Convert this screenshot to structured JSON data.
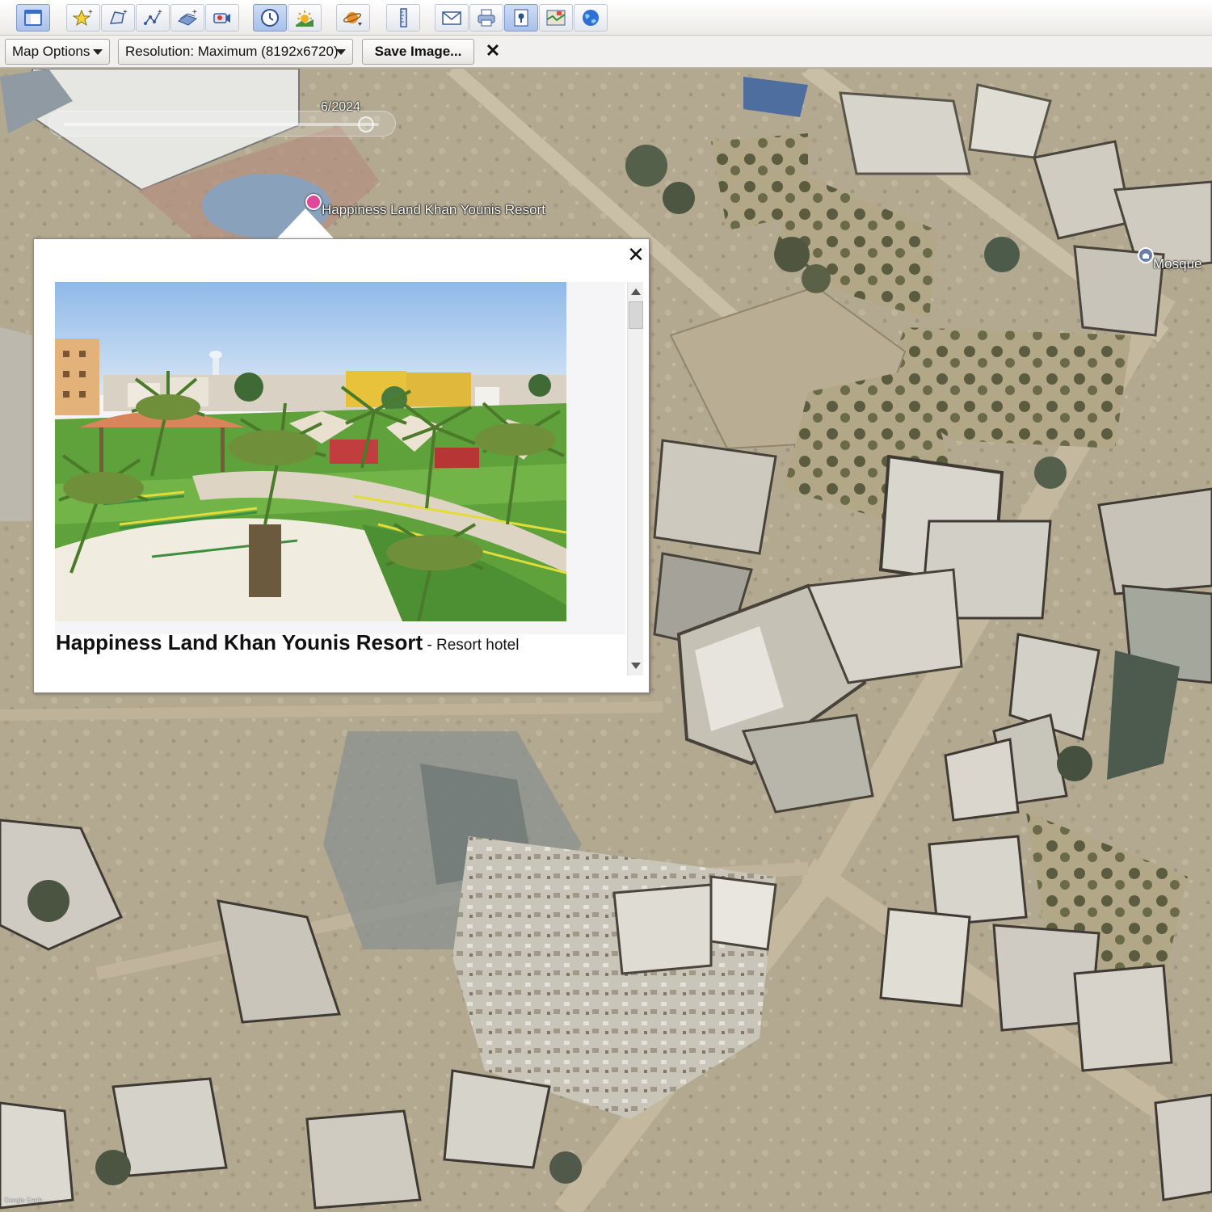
{
  "toolbar": {
    "buttons": [
      {
        "name": "sidebar-toggle",
        "icon": "sidebar-icon",
        "active": false
      },
      {
        "name": "add-placemark",
        "icon": "placemark-icon",
        "active": false
      },
      {
        "name": "add-polygon",
        "icon": "polygon-icon",
        "active": false
      },
      {
        "name": "add-path",
        "icon": "path-icon",
        "active": false
      },
      {
        "name": "add-image-overlay",
        "icon": "image-overlay-icon",
        "active": false
      },
      {
        "name": "record-tour",
        "icon": "record-tour-icon",
        "active": false
      },
      {
        "name": "historical-imagery",
        "icon": "clock-icon",
        "active": true
      },
      {
        "name": "sunlight",
        "icon": "sun-icon",
        "active": false
      },
      {
        "name": "switch-planet",
        "icon": "planet-icon",
        "active": false
      },
      {
        "name": "ruler",
        "icon": "ruler-icon",
        "active": false
      },
      {
        "name": "email",
        "icon": "email-icon",
        "active": false
      },
      {
        "name": "print",
        "icon": "print-icon",
        "active": false
      },
      {
        "name": "save-image",
        "icon": "save-image-icon",
        "active": true
      },
      {
        "name": "view-in-maps",
        "icon": "maps-icon",
        "active": false
      },
      {
        "name": "earth-community",
        "icon": "globe-icon",
        "active": false
      }
    ]
  },
  "options": {
    "map_options_label": "Map Options",
    "resolution_label": "Resolution: Maximum (8192x6720)",
    "save_image_label": "Save Image...",
    "close_label": "✕"
  },
  "map": {
    "time_label": "6/2024",
    "pin_label": "Happiness Land Khan Younis Resort",
    "mosque_label": "Mosque",
    "copyright": "Google Earth"
  },
  "balloon": {
    "close_label": "✕",
    "title": "Happiness Land Khan Younis Resort",
    "separator": " - ",
    "type": "Resort hotel"
  },
  "colors": {
    "active_button": "#a9c0ea",
    "pin": "#e1479a",
    "mosque": "#6b7fa6"
  }
}
